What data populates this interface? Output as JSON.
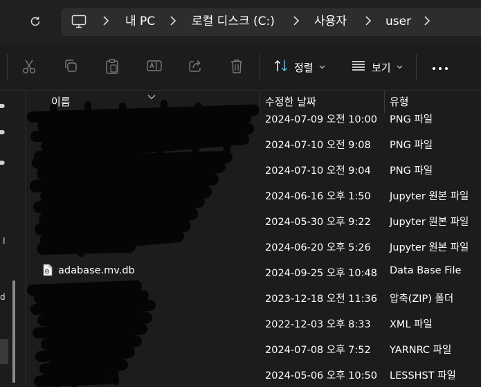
{
  "address_bar": {
    "breadcrumbs": [
      "내 PC",
      "로컬 디스크 (C:)",
      "사용자",
      "user"
    ]
  },
  "icons": {
    "refresh": "refresh-icon",
    "pc": "monitor-icon",
    "cut": "scissors-icon",
    "copy": "copy-icon",
    "paste": "clipboard-icon",
    "rename": "rename-icon",
    "share": "share-icon",
    "delete": "trash-icon",
    "sort": "sort-arrows-icon",
    "view": "list-view-icon",
    "more": "more-dots-icon",
    "file": "database-file-icon"
  },
  "toolbar": {
    "sort_label": "정렬",
    "view_label": "보기"
  },
  "nav": {
    "fragments": [
      "I",
      "d",
      "<"
    ]
  },
  "columns": {
    "name": "이름",
    "date": "수정한 날짜",
    "type": "유형"
  },
  "rows": [
    {
      "name": "",
      "date": "2024-07-09 오전 10:00",
      "type": "PNG 파일"
    },
    {
      "name": "",
      "date": "2024-07-10 오전 9:08",
      "type": "PNG 파일"
    },
    {
      "name": "",
      "date": "2024-07-10 오전 9:04",
      "type": "PNG 파일"
    },
    {
      "name": "",
      "date": "2024-06-16 오후 1:50",
      "type": "Jupyter 원본 파일"
    },
    {
      "name": "",
      "date": "2024-05-30 오후 9:22",
      "type": "Jupyter 원본 파일"
    },
    {
      "name": "",
      "date": "2024-06-20 오후 5:26",
      "type": "Jupyter 원본 파일"
    },
    {
      "name": "adabase.mv.db",
      "date": "2024-09-25 오후 10:48",
      "type": "Data Base File"
    },
    {
      "name": "",
      "date": "2023-12-18 오전 11:36",
      "type": "압축(ZIP) 폴더"
    },
    {
      "name": "",
      "date": "2022-12-03 오후 8:33",
      "type": "XML 파일"
    },
    {
      "name": "",
      "date": "2024-07-08 오후 7:52",
      "type": "YARNRC 파일"
    },
    {
      "name": "",
      "date": "2024-05-06 오후 10:50",
      "type": "LESSHST 파일"
    }
  ],
  "colors": {
    "background": "#1c1c1c",
    "address_box": "#2d2d2d",
    "text": "#ffffff",
    "disabled_icon": "#7a7a7a",
    "accent": "#4cc2ff"
  }
}
